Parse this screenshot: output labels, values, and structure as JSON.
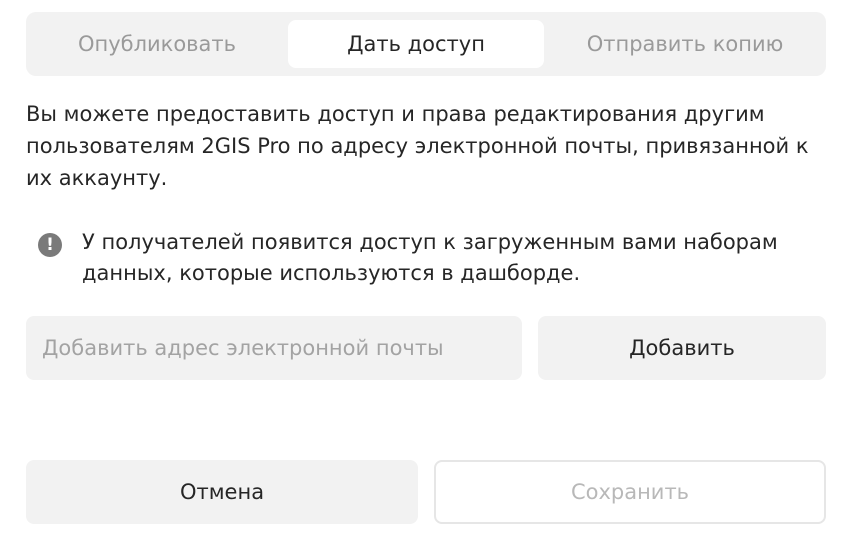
{
  "tabs": [
    {
      "label": "Опубликовать",
      "active": false
    },
    {
      "label": "Дать доступ",
      "active": true
    },
    {
      "label": "Отправить копию",
      "active": false
    }
  ],
  "description": "Вы можете предоставить доступ и права редактирования другим пользователям 2GIS Pro по адресу электронной почты, привязанной к их аккаунту.",
  "notice": {
    "icon": "exclamation-icon",
    "icon_glyph": "!",
    "text": "У получателей появится доступ к загруженным вами наборам данных, которые используются в дашборде."
  },
  "email": {
    "value": "",
    "placeholder": "Добавить адрес электронной почты"
  },
  "add_button": {
    "label": "Добавить"
  },
  "footer": {
    "cancel_label": "Отмена",
    "save_label": "Сохранить",
    "save_disabled": true
  },
  "colors": {
    "surface": "#f2f2f2",
    "text": "#262626",
    "muted_text": "#9a9a9a",
    "disabled_text": "#b8b8b8",
    "icon": "#7a7a7a"
  }
}
